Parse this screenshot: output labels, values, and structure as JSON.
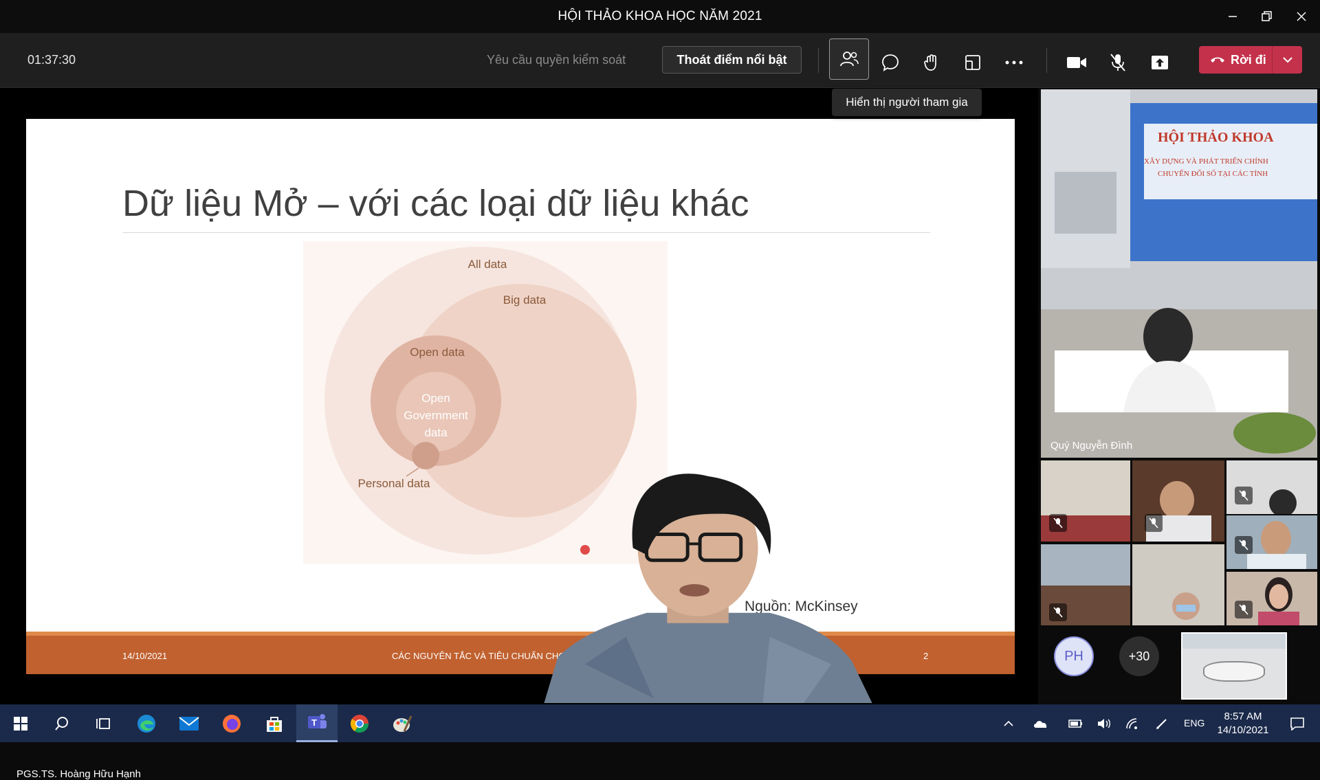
{
  "window": {
    "title": "HỘI THẢO KHOA HỌC NĂM 2021"
  },
  "toolbar": {
    "timer": "01:37:30",
    "request_control": "Yêu cầu quyền kiểm soát",
    "stop_spotlight": "Thoát điểm nổi bật",
    "leave": "Rời đi",
    "tooltip": "Hiển thị người tham gia"
  },
  "slide": {
    "title": "Dữ liệu Mở – với các loại dữ liệu khác",
    "diagram": {
      "all": "All data",
      "big": "Big data",
      "open": "Open data",
      "gov_line1": "Open",
      "gov_line2": "Government",
      "gov_line3": "data",
      "personal": "Personal data"
    },
    "source": "Nguồn: McKinsey",
    "footer_date": "14/10/2021",
    "footer_text": "CÁC NGUYÊN TẮC VÀ TIÊU CHUẨN CHO VIỆC XỬ",
    "page_number": "2"
  },
  "speaker": {
    "name": "PGS.TS. Hoàng Hữu Hạnh"
  },
  "participants": {
    "featured_name": "Quý Nguyễn Đình",
    "avatar_initials": "PH",
    "overflow_count": "+30",
    "banner_line1": "HỘI THẢO KHOA",
    "banner_line2": "XÂY DỰNG VÀ PHÁT TRIỂN CHÍNH",
    "banner_line3": "CHUYỂN ĐỔI SỐ TẠI CÁC TỈNH"
  },
  "taskbar": {
    "language": "ENG",
    "time": "8:57 AM",
    "date": "14/10/2021"
  },
  "colors": {
    "leave_button": "#c4314b",
    "slide_footer": "#c0612f",
    "taskbar": "#1b2a4a"
  }
}
